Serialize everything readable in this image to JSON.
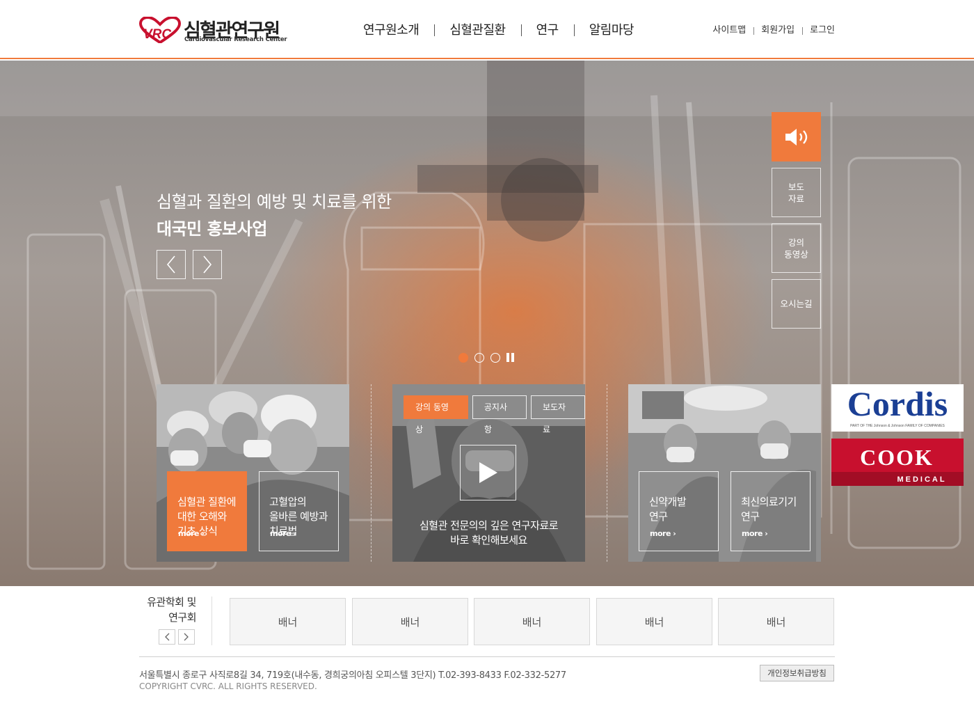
{
  "logo": {
    "ko": "심혈관연구원",
    "en": "Cardiovascular Research Center",
    "mark": "VRC"
  },
  "gnb": [
    "연구원소개",
    "심혈관질환",
    "연구",
    "알림마당"
  ],
  "util": [
    "사이트맵",
    "회원가입",
    "로그인"
  ],
  "hero": {
    "line1": "심혈과 질환의 예방 및 치료를 위한",
    "line2": "대국민 홍보사업",
    "slide_count": 3,
    "active_slide": 1
  },
  "side": {
    "press": "보도\n자료",
    "lecture": "강의\n동영상",
    "directions": "오시는길"
  },
  "card_left": {
    "box1": "심혈관 질환에\n대한 오해와\n기초 상식",
    "box2": "고혈압의\n올바른 예방과\n치료법",
    "more": "more ›"
  },
  "card_mid": {
    "tabs": [
      "강의 동영상",
      "공지사항",
      "보도자료"
    ],
    "caption": "심혈관 전문의의 깊은 연구자료로\n바로 확인해보세요"
  },
  "card_right": {
    "box1": "신약개발\n연구",
    "box2": "최신의료기기\n연구",
    "more": "more ›"
  },
  "sponsors": {
    "cordis": "Cordis",
    "cordis_sub": "PART OF THE Johnson & Johnson FAMILY OF COMPANIES",
    "cook": "COOK",
    "cook_sub": "MEDICAL"
  },
  "related": {
    "title": "유관학회 및\n연구회",
    "banners": [
      "배너",
      "배너",
      "배너",
      "배너",
      "배너"
    ]
  },
  "footer": {
    "address": "서울특별시 종로구 사직로8길 34, 719호(내수동, 경희궁의아침 오피스텔 3단지) T.02-393-8433 F.02-332-5277",
    "copyright": "COPYRIGHT CVRC. ALL RIGHTS RESERVED.",
    "privacy": "개인정보취급방침"
  },
  "colors": {
    "accent": "#f07a3c",
    "logo_red": "#c8102e",
    "cordis_blue": "#1b3f94",
    "cook_red": "#c8102e"
  }
}
